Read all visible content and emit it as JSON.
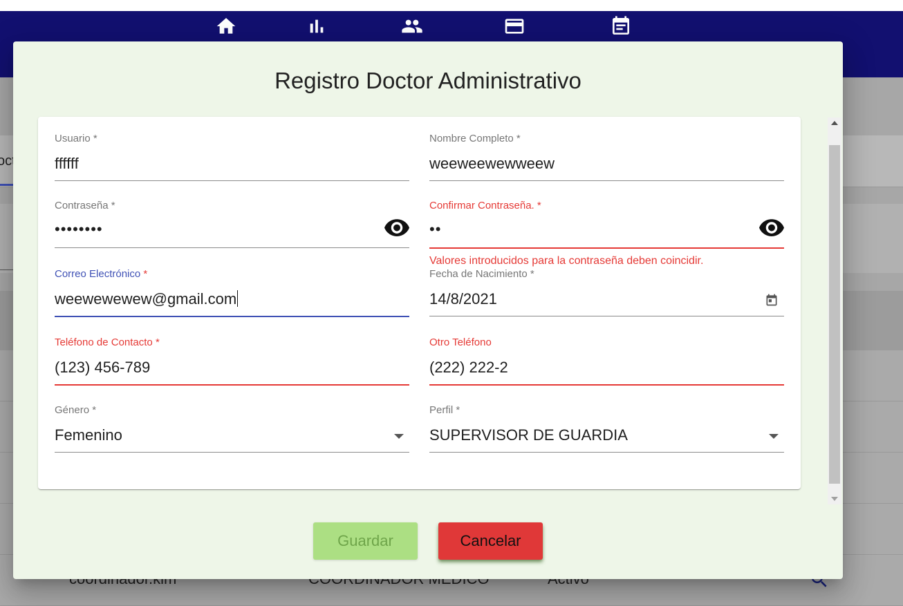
{
  "nav": {
    "icons": [
      "home-icon",
      "bar-chart-icon",
      "people-icon",
      "credit-card-icon",
      "calendar-note-icon"
    ]
  },
  "background": {
    "tab_partial": "oct",
    "row": {
      "user": "coordinador.kim",
      "profile": "COORDINADOR MEDICO",
      "status": "Activo"
    }
  },
  "dialog": {
    "title": "Registro Doctor Administrativo",
    "fields": {
      "usuario": {
        "label": "Usuario",
        "required": "*",
        "value": "ffffff"
      },
      "nombre": {
        "label": "Nombre Completo",
        "required": "*",
        "value": "weeweewewweew"
      },
      "contrasena": {
        "label": "Contraseña",
        "required": "*",
        "value": "••••••••"
      },
      "confirmar": {
        "label": "Confirmar Contraseña.",
        "required": "*",
        "value": "••",
        "error": "Valores introducidos para la contraseña deben coincidir."
      },
      "correo": {
        "label": "Correo Electrónico",
        "required": "*",
        "value": "weewewewew@gmail.com"
      },
      "fecha": {
        "label": "Fecha de Nacimiento",
        "required": "*",
        "value": "14/8/2021"
      },
      "telefono": {
        "label": "Teléfono de Contacto",
        "required": "*",
        "value": "(123) 456-789"
      },
      "otro_telefono": {
        "label": "Otro Teléfono",
        "value": "(222) 222-2"
      },
      "genero": {
        "label": "Género",
        "required": "*",
        "value": "Femenino"
      },
      "perfil": {
        "label": "Perfil",
        "required": "*",
        "value": "SUPERVISOR DE GUARDIA"
      }
    },
    "buttons": {
      "save": "Guardar",
      "cancel": "Cancelar"
    }
  },
  "colors": {
    "topbar": "#121070",
    "dialog_bg": "#eef6e8",
    "error": "#e53935",
    "focus": "#3f51b5",
    "save_button": "#acdf83",
    "cancel_button": "#e03838"
  }
}
